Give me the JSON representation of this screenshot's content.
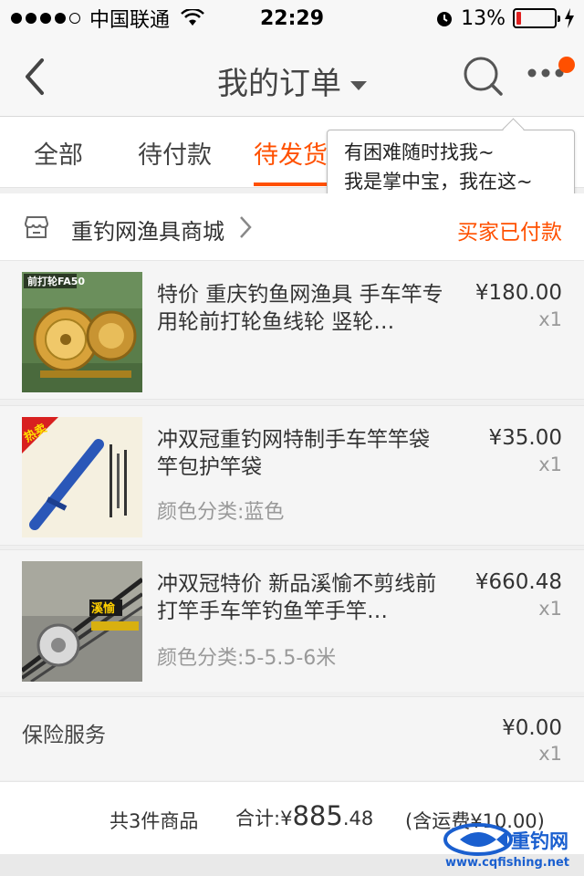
{
  "status_bar": {
    "carrier": "中国联通",
    "time": "22:29",
    "battery": "13%",
    "battery_level": 0.13,
    "signal_bars_filled": 4,
    "signal_bars_total": 5
  },
  "nav": {
    "title": "我的订单"
  },
  "tabs": [
    {
      "label": "全部"
    },
    {
      "label": "待付款"
    },
    {
      "label": "待发货"
    }
  ],
  "tooltip": {
    "line1": "有困难随时找我~",
    "line2": "我是掌中宝，我在这~"
  },
  "shop": {
    "name": "重钓网渔具商城",
    "status": "买家已付款"
  },
  "items": [
    {
      "title": "特价 重庆钓鱼网渔具 手车竿专用轮前打轮鱼线轮 竖轮…",
      "price": "¥180.00",
      "qty": "x1",
      "sku": "",
      "image_text": "前打轮FA50"
    },
    {
      "title": "冲双冠重钓网特制手车竿竿袋 竿包护竿袋",
      "price": "¥35.00",
      "qty": "x1",
      "sku": "颜色分类:蓝色",
      "image_text": "热卖"
    },
    {
      "title": "冲双冠特价 新品溪愉不剪线前打竿手车竿钓鱼竿手竿…",
      "price": "¥660.48",
      "qty": "x1",
      "sku": "颜色分类:5-5.5-6米",
      "image_text": "溪愉"
    }
  ],
  "insurance": {
    "label": "保险服务",
    "price": "¥0.00",
    "qty": "x1"
  },
  "summary": {
    "count": "共3件商品",
    "total_label": "合计:",
    "currency": "¥",
    "total_int": "885",
    "total_dec": ".48",
    "shipping": "(含运费¥10.00)"
  },
  "watermark": {
    "brand": "重钓网",
    "url": "www.cqfishing.net"
  },
  "colors": {
    "accent": "#ff5000",
    "watermark": "#1a5fcf"
  }
}
